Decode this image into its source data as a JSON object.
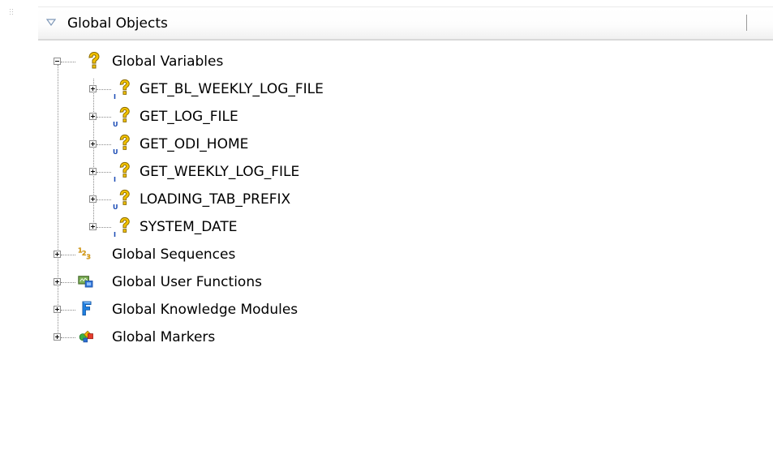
{
  "panel": {
    "title": "Global Objects"
  },
  "tree": {
    "global_variables": {
      "label": "Global Variables",
      "children": [
        {
          "label": "GET_BL_WEEKLY_LOG_FILE",
          "badge": "I"
        },
        {
          "label": "GET_LOG_FILE",
          "badge": "U"
        },
        {
          "label": "GET_ODI_HOME",
          "badge": "U"
        },
        {
          "label": "GET_WEEKLY_LOG_FILE",
          "badge": "I"
        },
        {
          "label": "LOADING_TAB_PREFIX",
          "badge": "U"
        },
        {
          "label": "SYSTEM_DATE",
          "badge": "I"
        }
      ]
    },
    "global_sequences": {
      "label": "Global Sequences"
    },
    "global_user_functions": {
      "label": "Global User Functions"
    },
    "global_knowledge_modules": {
      "label": "Global Knowledge Modules"
    },
    "global_markers": {
      "label": "Global Markers"
    }
  },
  "colors": {
    "variable_icon": "#f2c200",
    "badge_text": "#1a4bb5",
    "sequence_icon": "#e8a817",
    "knowledge_module_icon": "#1f7fe0"
  }
}
